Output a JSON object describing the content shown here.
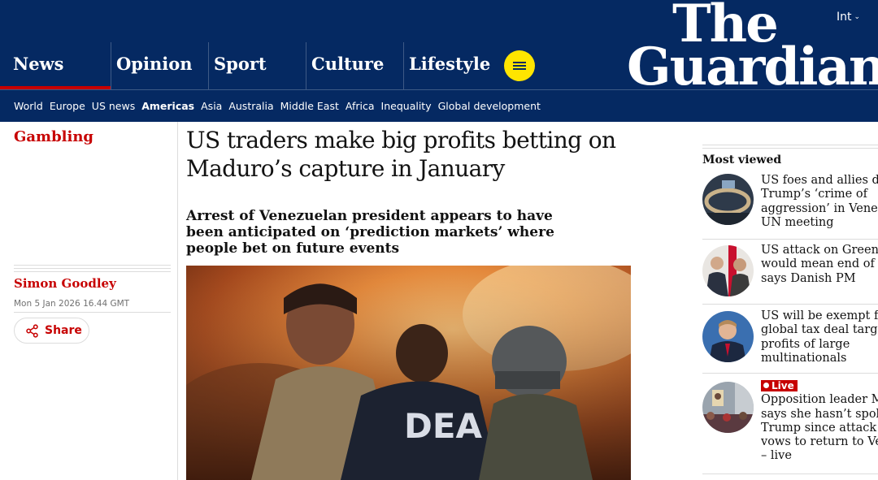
{
  "header": {
    "edition": "Int",
    "logo_line1": "The",
    "logo_line2": "Guardian",
    "pillars": [
      "News",
      "Opinion",
      "Sport",
      "Culture",
      "Lifestyle"
    ],
    "subnav": [
      "World",
      "Europe",
      "US news",
      "Americas",
      "Asia",
      "Australia",
      "Middle East",
      "Africa",
      "Inequality",
      "Global development"
    ],
    "active_subnav": "Americas"
  },
  "article": {
    "section": "Gambling",
    "headline": "US traders make big profits betting on Maduro’s capture in January",
    "standfirst": "Arrest of Venezuelan president appears to have been anticipated on ‘prediction markets’ where people bet on future events",
    "author": "Simon Goodley",
    "date": "Mon 5 Jan 2026 16.44 GMT",
    "share_label": "Share",
    "hero_jacket_text": "DEA"
  },
  "most_viewed": {
    "title": "Most viewed",
    "items": [
      {
        "lines": [
          "US foes and allies den",
          "Trump’s ‘crime of",
          "aggression’ in Venezu",
          "UN meeting"
        ],
        "live": false
      },
      {
        "lines": [
          "US attack on Greenlan",
          "would mean end of Na",
          "says Danish PM"
        ],
        "live": false
      },
      {
        "lines": [
          "US will be exempt fro",
          "global tax deal targeti",
          "profits of large",
          "multinationals"
        ],
        "live": false
      },
      {
        "lines": [
          "Opposition leader Ma",
          "says she hasn’t spoke",
          "Trump since attack as",
          "vows to return to Ven",
          "– live"
        ],
        "live": true,
        "live_label": "Live"
      }
    ]
  },
  "colors": {
    "brand_blue": "#052962",
    "news_red": "#c70000",
    "menu_yellow": "#ffe500"
  }
}
